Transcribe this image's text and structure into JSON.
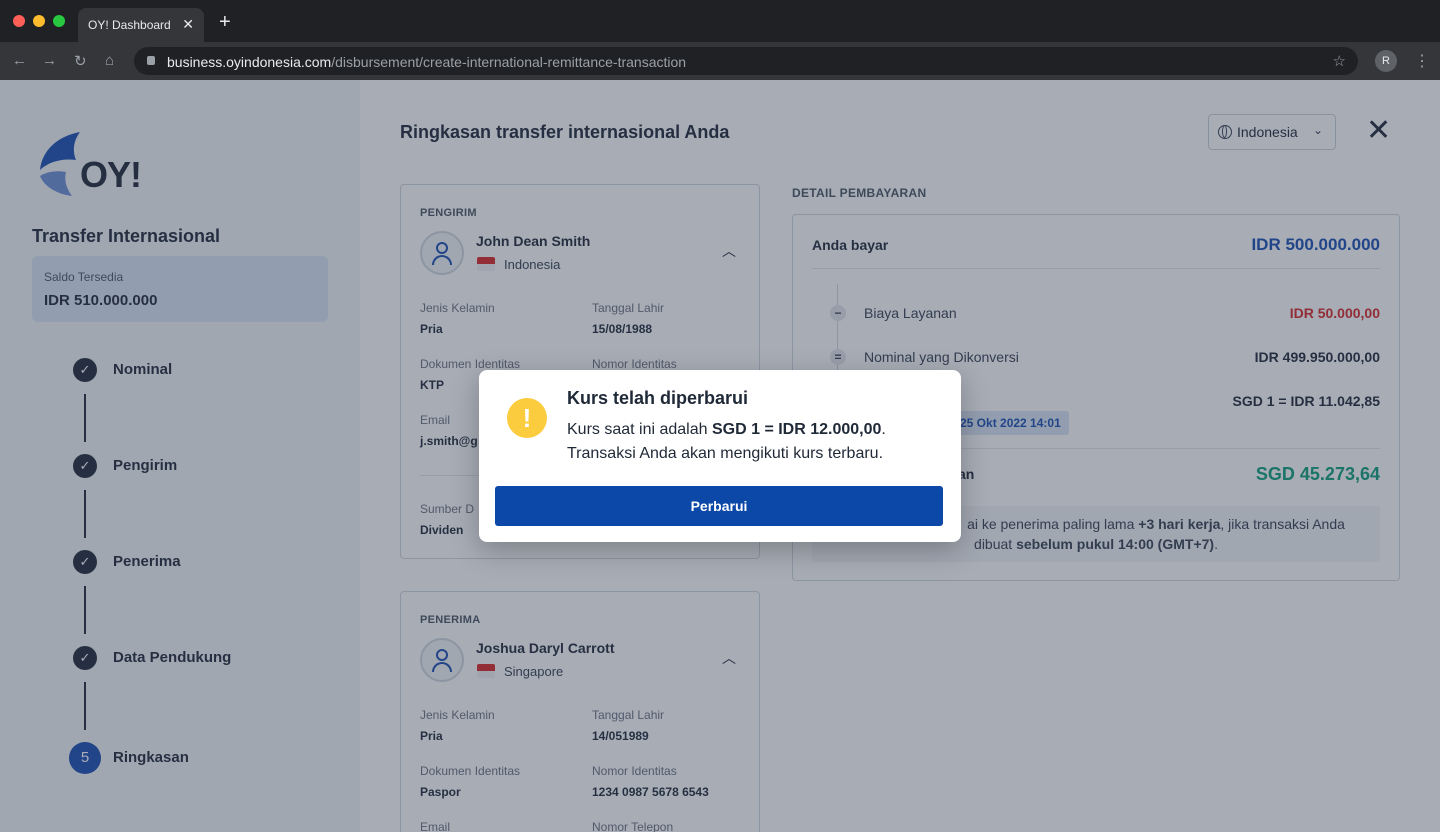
{
  "browser": {
    "tab_title": "OY! Dashboard",
    "url_host": "business.oyindonesia.com",
    "url_path": "/disbursement/create-international-remittance-transaction",
    "profile_initial": "R"
  },
  "sidebar": {
    "logo_text": "OY!",
    "title": "Transfer Internasional",
    "saldo_label": "Saldo Tersedia",
    "saldo_value": "IDR 510.000.000",
    "steps": [
      {
        "label": "Nominal",
        "icon": "check-icon"
      },
      {
        "label": "Pengirim",
        "icon": "check-icon"
      },
      {
        "label": "Penerima",
        "icon": "check-icon"
      },
      {
        "label": "Data Pendukung",
        "icon": "check-icon"
      },
      {
        "label": "Ringkasan",
        "number": "5"
      }
    ]
  },
  "main": {
    "title": "Ringkasan transfer internasional Anda",
    "language": "Indonesia"
  },
  "sender": {
    "section": "PENGIRIM",
    "name": "John Dean Smith",
    "country": "Indonesia",
    "fields": {
      "gender_label": "Jenis Kelamin",
      "gender": "Pria",
      "dob_label": "Tanggal Lahir",
      "dob": "15/08/1988",
      "doc_label": "Dokumen Identitas",
      "doc": "KTP",
      "id_label": "Nomor Identitas",
      "email_label": "Email",
      "email": "j.smith@g",
      "source_label": "Sumber D",
      "source": "Dividen"
    }
  },
  "recipient": {
    "section": "PENERIMA",
    "name": "Joshua Daryl Carrott",
    "country": "Singapore",
    "fields": {
      "gender_label": "Jenis Kelamin",
      "gender": "Pria",
      "dob_label": "Tanggal Lahir",
      "dob": "14/051989",
      "doc_label": "Dokumen Identitas",
      "doc": "Paspor",
      "id_label": "Nomor Identitas",
      "id": "1234 0987 5678 6543",
      "email_label": "Email",
      "phone_label": "Nomor Telepon"
    }
  },
  "payment": {
    "section": "DETAIL PEMBAYARAN",
    "pay_label": "Anda bayar",
    "pay_value": "IDR 500.000.000",
    "fee_label": "Biaya Layanan",
    "fee_value": "IDR 50.000,00",
    "converted_label": "Nominal yang Dikonversi",
    "converted_value": "IDR 499.950.000,00",
    "rate_value": "SGD 1 = IDR 11.042,85",
    "rate_time": "25 Okt 2022 14:01",
    "receive_label_partial": "an",
    "receive_value": "SGD 45.273,64",
    "note_line1_a": "ai ke penerima paling lama ",
    "note_line1_b": "+3 hari kerja",
    "note_line1_c": ", jika transaksi Anda",
    "note_line2_a": "dibuat ",
    "note_line2_b": "sebelum pukul 14:00 (GMT+7)",
    "note_line2_c": "."
  },
  "modal": {
    "title": "Kurs telah diperbarui",
    "line1_a": "Kurs saat ini adalah ",
    "line1_b": "SGD 1 = IDR 12.000,00",
    "line1_c": ".",
    "line2": "Transaksi Anda akan mengikuti kurs terbaru.",
    "button": "Perbarui",
    "warn_symbol": "!"
  },
  "colors": {
    "primary": "#0c48a8",
    "warning": "#fbcc3d",
    "fee_red": "#dc2626",
    "receive_green": "#0f9f7a",
    "pay_blue": "#1a4fb3"
  }
}
